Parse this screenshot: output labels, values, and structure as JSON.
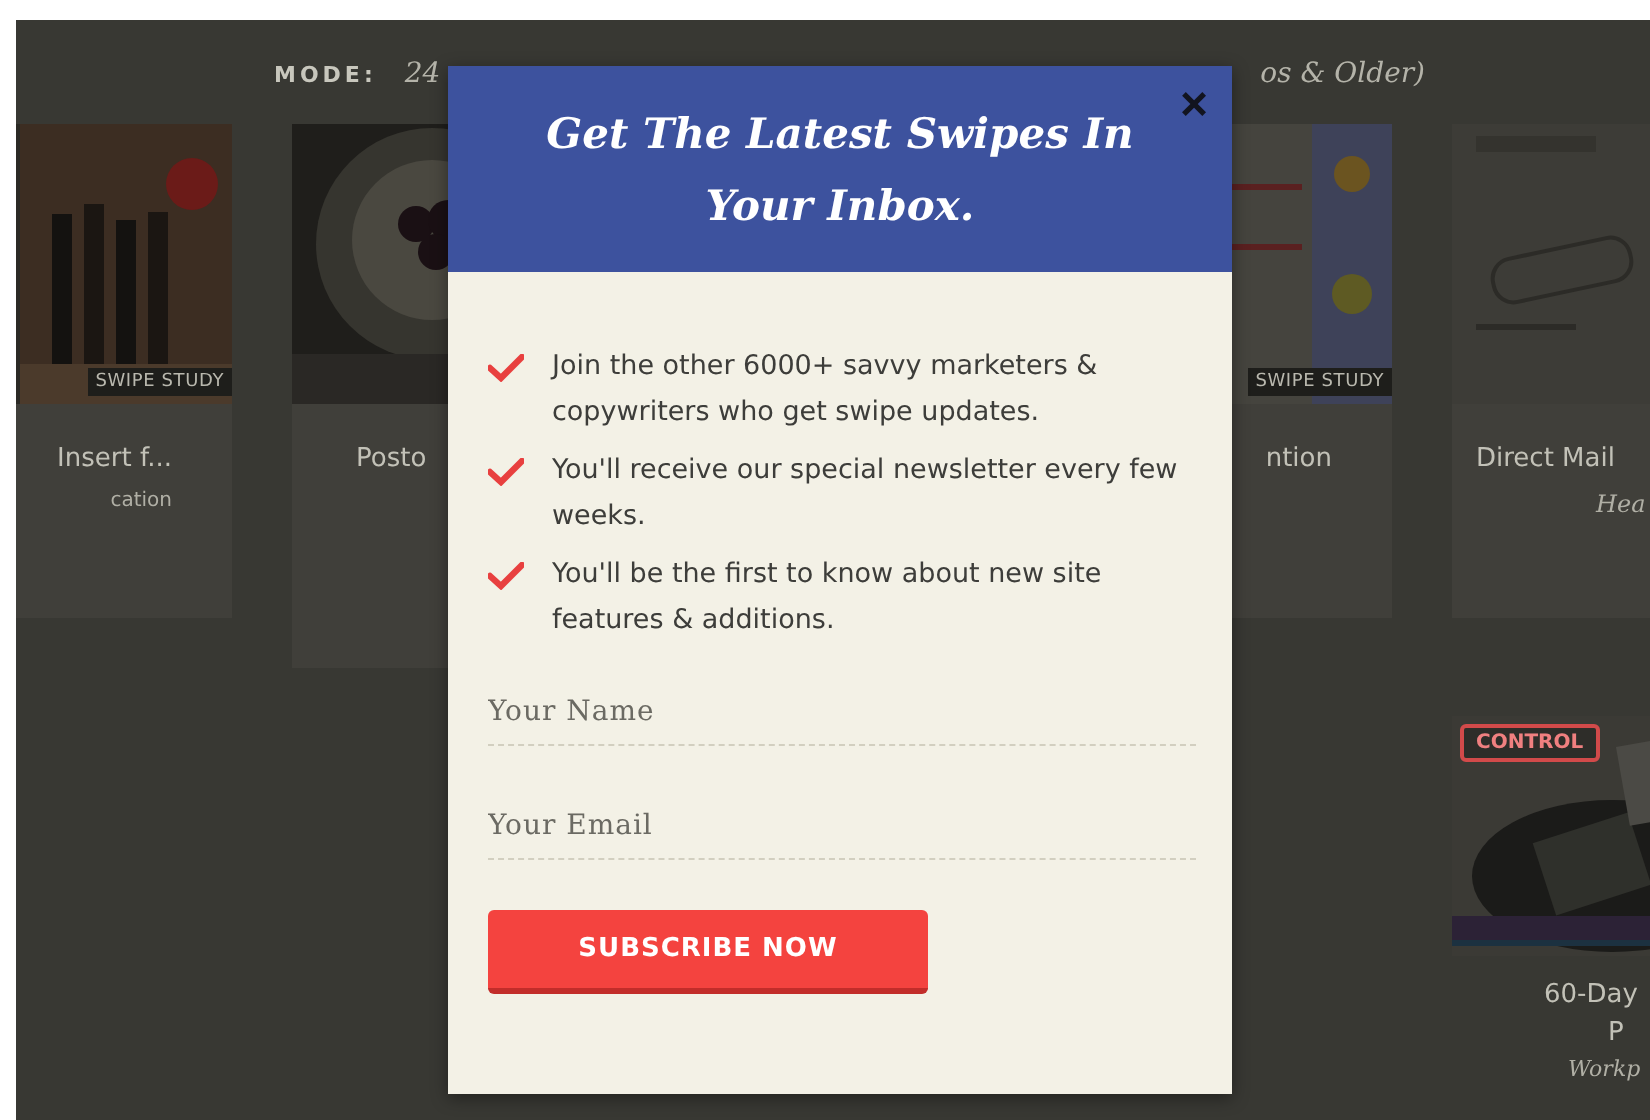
{
  "mode_bar": {
    "label": "MODE:",
    "options": [
      "24",
      "os & Older)"
    ]
  },
  "cards": [
    {
      "badge": "SWIPE STUDY",
      "title": "Insert f...",
      "subtitle": "cation"
    },
    {
      "title": "Posto"
    },
    {
      "badge": "SWIPE STUDY",
      "title": "ntion"
    },
    {
      "title": "Direct Mail",
      "subtitle": "Hea"
    },
    {
      "stamp": "CONTROL",
      "title": "60-Day",
      "title_line_2": "P",
      "subtitle": "Workp"
    }
  ],
  "modal": {
    "title": "Get The Latest Swipes In Your Inbox.",
    "close": "×",
    "bullets": [
      "Join the other 6000+ savvy marketers & copywriters who get swipe updates.",
      "You'll receive our special newsletter every few weeks.",
      "You'll be the first to know about new site features & additions."
    ],
    "fields": [
      {
        "placeholder": "Your Name"
      },
      {
        "placeholder": "Your Email"
      }
    ],
    "button": "SUBSCRIBE NOW"
  }
}
